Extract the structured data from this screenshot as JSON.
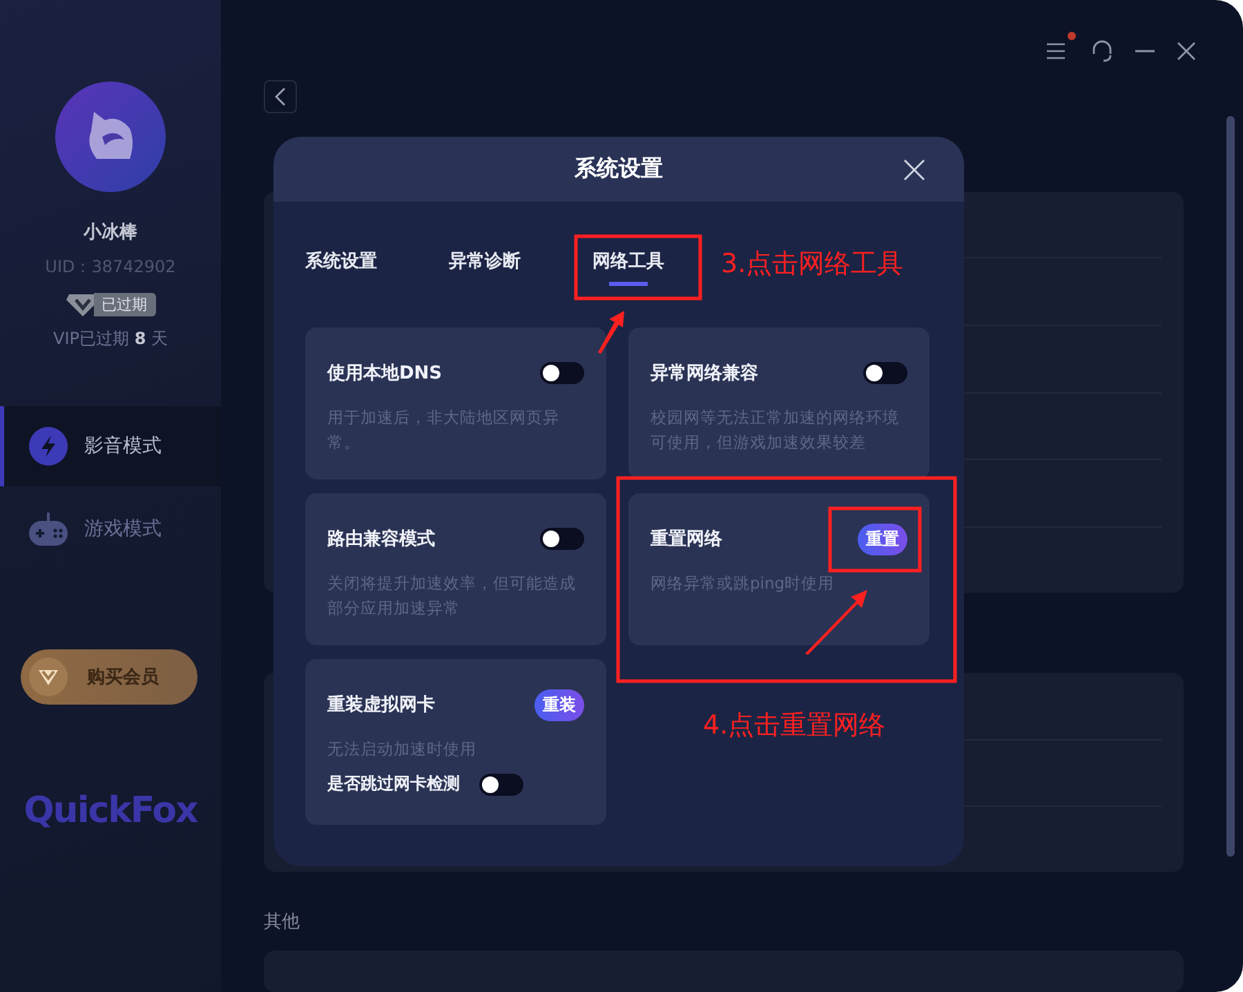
{
  "window": {
    "has_notification": true
  },
  "sidebar": {
    "user_name": "小冰棒",
    "uid": "UID：38742902",
    "badge": "已过期",
    "vip_text": "VIP已过期 **8** 天",
    "nav_items": [
      {
        "label": "影音模式",
        "selected": true
      },
      {
        "label": "游戏模式",
        "selected": false
      }
    ],
    "buy_button": "购买会员",
    "logo": "QuickFox"
  },
  "main": {
    "other_heading": "其他"
  },
  "modal": {
    "title": "系统设置",
    "tabs": [
      {
        "label": "系统设置",
        "selected": false
      },
      {
        "label": "异常诊断",
        "selected": false
      },
      {
        "label": "网络工具",
        "selected": true
      }
    ],
    "cards": [
      {
        "kind": "toggle",
        "title": "使用本地DNS",
        "description": "用于加速后，非大陆地区网页异常。",
        "on": false
      },
      {
        "kind": "toggle",
        "title": "异常网络兼容",
        "description": "校园网等无法正常加速的网络环境可使用，但游戏加速效果较差",
        "on": false
      },
      {
        "kind": "toggle",
        "title": "路由兼容模式",
        "description": "关闭将提升加速效率，但可能造成部分应用加速异常",
        "on": false
      },
      {
        "kind": "action",
        "title": "重置网络",
        "description": "网络异常或跳ping时使用",
        "button": "重置"
      },
      {
        "kind": "action",
        "title": "重装虚拟网卡",
        "description": "无法启动加速时使用",
        "button": "重装",
        "toggle_label": "是否跳过网卡检测",
        "on": false
      }
    ]
  },
  "annotations": [
    {
      "text": "3.点击网络工具"
    },
    {
      "text": "4.点击重置网络"
    }
  ]
}
